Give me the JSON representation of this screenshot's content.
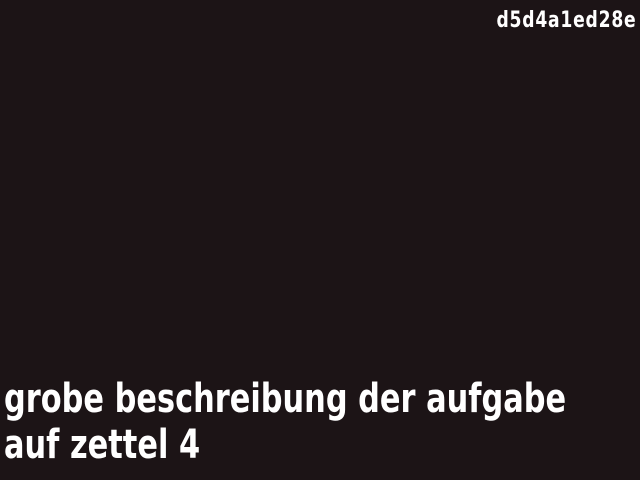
{
  "video": {
    "id_label": "d5d4a1ed28e",
    "caption_lines": [
      "grobe beschreibung der aufgabe",
      "auf zettel 4"
    ],
    "colors": {
      "background": "#1c1416",
      "text": "#ffffff"
    }
  }
}
